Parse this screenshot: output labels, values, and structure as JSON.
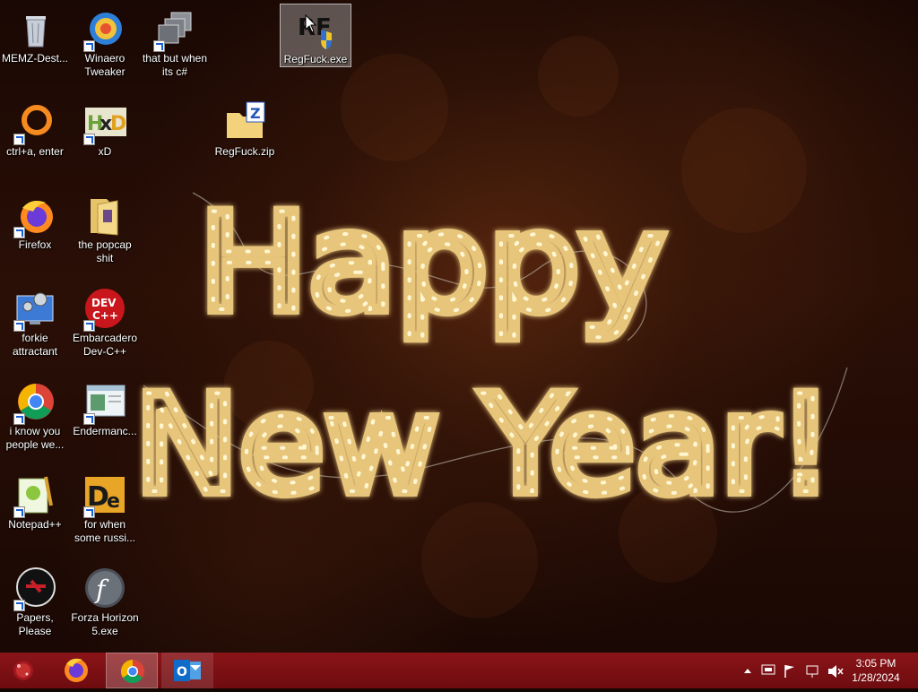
{
  "desktop": {
    "wallpaper_text": [
      "Happy",
      "New Year!"
    ],
    "icons": [
      {
        "label": "MEMZ-Dest...",
        "icon": "recycle-bin-icon"
      },
      {
        "label": "Winaero Tweaker",
        "icon": "winaero-icon"
      },
      {
        "label": "that but when its c#",
        "icon": "windows-stack-icon"
      },
      {
        "label": "RegFuck.exe",
        "icon": "regfuck-exe-icon"
      },
      {
        "label": "ctrl+a, enter",
        "icon": "orange-ring-icon"
      },
      {
        "label": "xD",
        "icon": "hxd-icon"
      },
      {
        "label": "RegFuck.zip",
        "icon": "zip-folder-icon"
      },
      {
        "label": "Firefox",
        "icon": "firefox-icon"
      },
      {
        "label": "the popcap shit",
        "icon": "folder-icon"
      },
      {
        "label": "forkie attractant",
        "icon": "settings-monitor-icon"
      },
      {
        "label": "Embarcadero Dev-C++",
        "icon": "devcpp-icon"
      },
      {
        "label": "i know you people we...",
        "icon": "chrome-icon"
      },
      {
        "label": "Endermanc...",
        "icon": "window-app-icon"
      },
      {
        "label": "Notepad++",
        "icon": "notepadpp-icon"
      },
      {
        "label": "for when some russi...",
        "icon": "de-icon"
      },
      {
        "label": "Papers, Please",
        "icon": "papers-please-icon"
      },
      {
        "label": "Forza Horizon 5.exe",
        "icon": "flash-icon"
      }
    ]
  },
  "taskbar": {
    "start_icon": "start-orb-icon",
    "pinned": [
      {
        "name": "Firefox",
        "icon": "firefox-icon",
        "active": false
      },
      {
        "name": "Google Chrome",
        "icon": "chrome-icon",
        "active": true
      },
      {
        "name": "Outlook",
        "icon": "outlook-icon",
        "active": false
      }
    ],
    "tray": {
      "time": "3:05 PM",
      "date": "1/28/2024"
    }
  },
  "colors": {
    "taskbar": "#7d1014",
    "selection": "#a0a0a0",
    "bulb": "#ffe9a8"
  }
}
